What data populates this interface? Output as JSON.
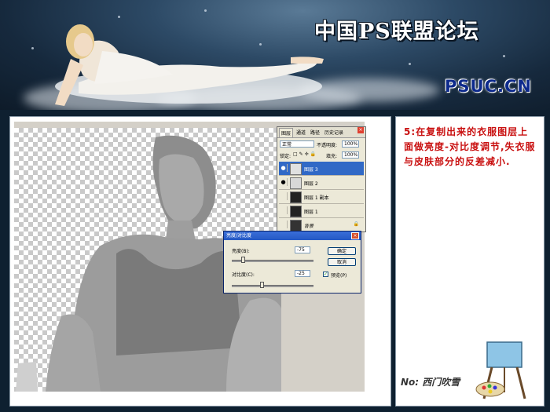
{
  "banner": {
    "title": "中国PS联盟论坛",
    "logo": "PSUC.CN"
  },
  "tutorial": {
    "step_text": "5:在复制出来的衣服图层上面做亮度-对比度调节,失衣服与皮肤部分的反差减小."
  },
  "layers_palette": {
    "tabs": [
      "图层",
      "通道",
      "路径",
      "历史记录"
    ],
    "blend_mode": "正常",
    "opacity_label": "不透明度:",
    "opacity_value": "100%",
    "lock_label": "锁定:",
    "fill_label": "填充:",
    "fill_value": "100%",
    "layers": [
      {
        "name": "图层 3",
        "selected": true,
        "visible": true
      },
      {
        "name": "图层 2",
        "selected": false,
        "visible": true
      },
      {
        "name": "图层 1 副本",
        "selected": false,
        "visible": false
      },
      {
        "name": "图层 1",
        "selected": false,
        "visible": false
      },
      {
        "name": "背景",
        "selected": false,
        "visible": false
      }
    ]
  },
  "brightness_dialog": {
    "title": "亮度/对比度",
    "brightness_label": "亮度(B):",
    "brightness_value": "-75",
    "contrast_label": "对比度(C):",
    "contrast_value": "-25",
    "ok_label": "确定",
    "cancel_label": "取消",
    "preview_label": "预览(P)",
    "preview_checked": true
  },
  "signature": "No: 西门吹雪"
}
